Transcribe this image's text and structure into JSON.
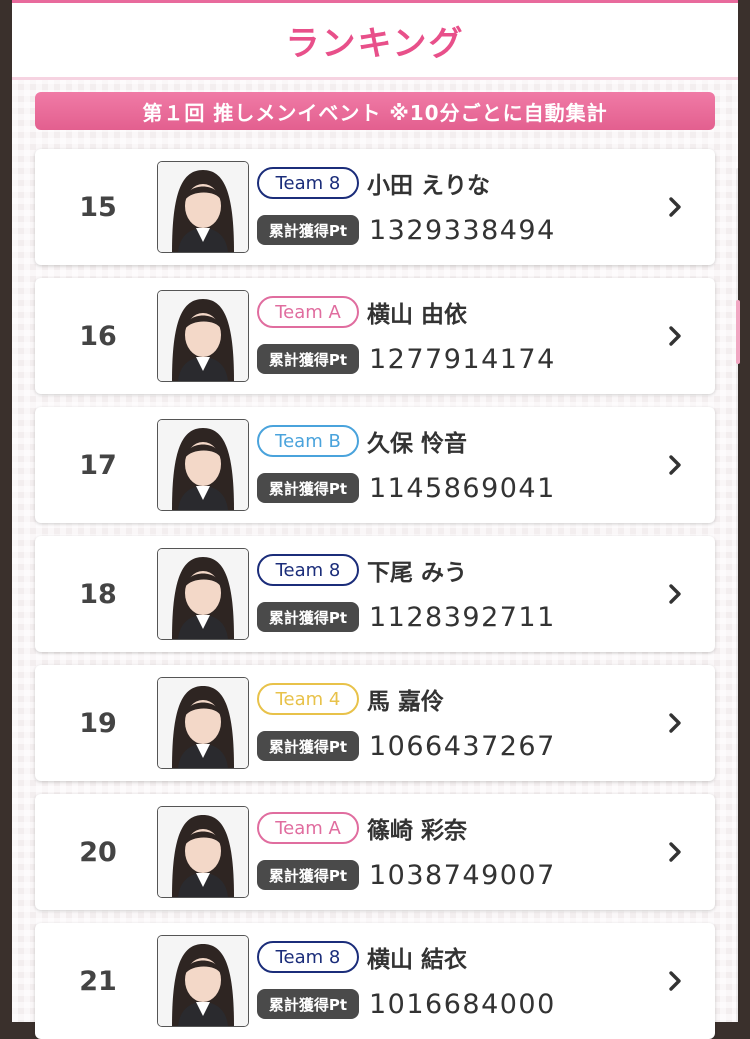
{
  "header": {
    "title": "ランキング"
  },
  "banner": {
    "text": "第１回 推しメンイベント ※10分ごとに自動集計"
  },
  "pt_label": "累計獲得Pt",
  "colors": {
    "accent_pink": "#e8508a",
    "team_8": "#1b2d7a",
    "team_a": "#e06d9f",
    "team_b": "#4aa3dc",
    "team_4": "#e8c24a"
  },
  "rankings": [
    {
      "rank": "15",
      "team": "Team 8",
      "team_color": "#1b2d7a",
      "name": "小田 えりな",
      "points": "1329338494",
      "photo_icon": "member-photo"
    },
    {
      "rank": "16",
      "team": "Team A",
      "team_color": "#e06d9f",
      "name": "横山 由依",
      "points": "1277914174",
      "photo_icon": "member-photo"
    },
    {
      "rank": "17",
      "team": "Team B",
      "team_color": "#4aa3dc",
      "name": "久保 怜音",
      "points": "1145869041",
      "photo_icon": "member-photo"
    },
    {
      "rank": "18",
      "team": "Team 8",
      "team_color": "#1b2d7a",
      "name": "下尾 みう",
      "points": "1128392711",
      "photo_icon": "member-photo"
    },
    {
      "rank": "19",
      "team": "Team 4",
      "team_color": "#e8c24a",
      "name": "馬 嘉伶",
      "points": "1066437267",
      "photo_icon": "member-photo"
    },
    {
      "rank": "20",
      "team": "Team A",
      "team_color": "#e06d9f",
      "name": "篠崎 彩奈",
      "points": "1038749007",
      "photo_icon": "member-photo"
    },
    {
      "rank": "21",
      "team": "Team 8",
      "team_color": "#1b2d7a",
      "name": "横山 結衣",
      "points": "1016684000",
      "photo_icon": "member-photo"
    }
  ]
}
